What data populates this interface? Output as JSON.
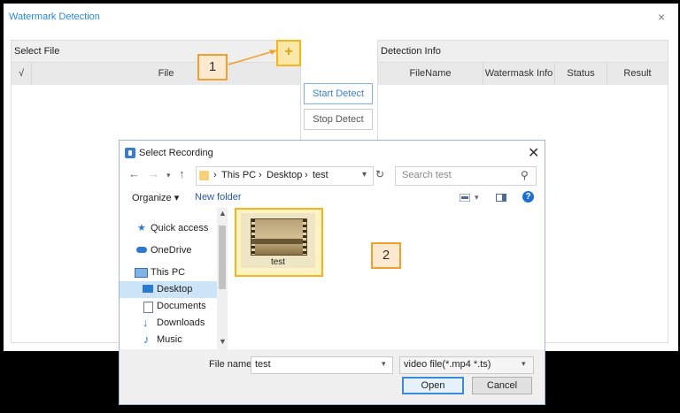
{
  "main": {
    "title": "Watermark Detection",
    "close_glyph": "×",
    "select_file": {
      "header": "Select File",
      "columns": [
        "√",
        "File"
      ]
    },
    "buttons": {
      "start": "Start Detect",
      "stop": "Stop Detect",
      "add_icon": "plus-icon",
      "add_glyph": "+"
    },
    "detection": {
      "header": "Detection Info",
      "columns": [
        "FileName",
        "Watermask Info",
        "Status",
        "Result"
      ]
    }
  },
  "callouts": {
    "one": "1",
    "two": "2"
  },
  "dialog": {
    "title": "Select Recording",
    "close_glyph": "✕",
    "nav": {
      "back": "←",
      "forward": "→",
      "up": "↑",
      "refresh": "↻"
    },
    "breadcrumb": [
      "This PC",
      "Desktop",
      "test"
    ],
    "breadcrumb_sep": "›",
    "search_placeholder": "Search test",
    "toolbar": {
      "organize": "Organize ▾",
      "new_folder": "New folder",
      "help": "?"
    },
    "nav_items": [
      {
        "label": "Quick access",
        "icon": "star-icon"
      },
      {
        "label": "OneDrive",
        "icon": "cloud-icon"
      },
      {
        "label": "This PC",
        "icon": "monitor-icon"
      },
      {
        "label": "Desktop",
        "icon": "desktop-icon",
        "selected": true
      },
      {
        "label": "Documents",
        "icon": "documents-icon"
      },
      {
        "label": "Downloads",
        "icon": "download-icon"
      },
      {
        "label": "Music",
        "icon": "music-icon"
      }
    ],
    "file": {
      "name": "test",
      "icon": "video-thumbnail-icon"
    },
    "file_name_label": "File name:",
    "file_name_value": "test",
    "file_type": "video file(*.mp4 *.ts)",
    "open_label": "Open",
    "cancel_label": "Cancel"
  },
  "colors": {
    "accent_blue": "#2a8ad8",
    "highlight_yellow": "#f5b51e",
    "callout_orange": "#f0a030",
    "selection_blue": "#cce4f7"
  }
}
